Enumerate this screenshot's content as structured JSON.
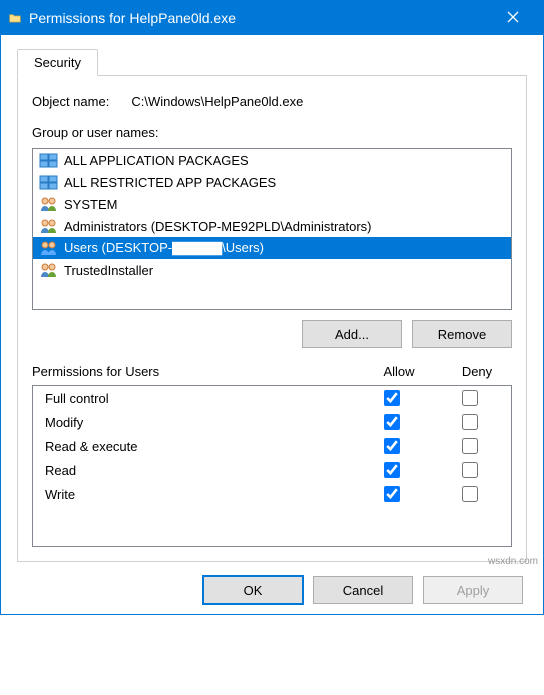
{
  "window": {
    "title": "Permissions for HelpPane0ld.exe"
  },
  "tabs": {
    "security": "Security"
  },
  "object": {
    "label": "Object name:",
    "path": "C:\\Windows\\HelpPane0ld.exe"
  },
  "groups": {
    "label": "Group or user names:",
    "items": [
      {
        "label": "ALL APPLICATION PACKAGES",
        "type": "pkg",
        "sel": false
      },
      {
        "label": "ALL RESTRICTED APP PACKAGES",
        "type": "pkg",
        "sel": false
      },
      {
        "label": "SYSTEM",
        "type": "grp",
        "sel": false
      },
      {
        "label": "Administrators (DESKTOP-ME92PLD\\Administrators)",
        "type": "grp",
        "sel": false
      },
      {
        "label": "Users (DESKTOP-▇▇▇▇▇\\Users)",
        "type": "grp",
        "sel": true
      },
      {
        "label": "TrustedInstaller",
        "type": "grp",
        "sel": false
      }
    ],
    "add": "Add...",
    "remove": "Remove"
  },
  "perms": {
    "label": "Permissions for Users",
    "col_allow": "Allow",
    "col_deny": "Deny",
    "rows": [
      {
        "name": "Full control",
        "allow": true,
        "deny": false
      },
      {
        "name": "Modify",
        "allow": true,
        "deny": false
      },
      {
        "name": "Read & execute",
        "allow": true,
        "deny": false
      },
      {
        "name": "Read",
        "allow": true,
        "deny": false
      },
      {
        "name": "Write",
        "allow": true,
        "deny": false
      }
    ]
  },
  "buttons": {
    "ok": "OK",
    "cancel": "Cancel",
    "apply": "Apply"
  },
  "watermark": "wsxdn.com"
}
